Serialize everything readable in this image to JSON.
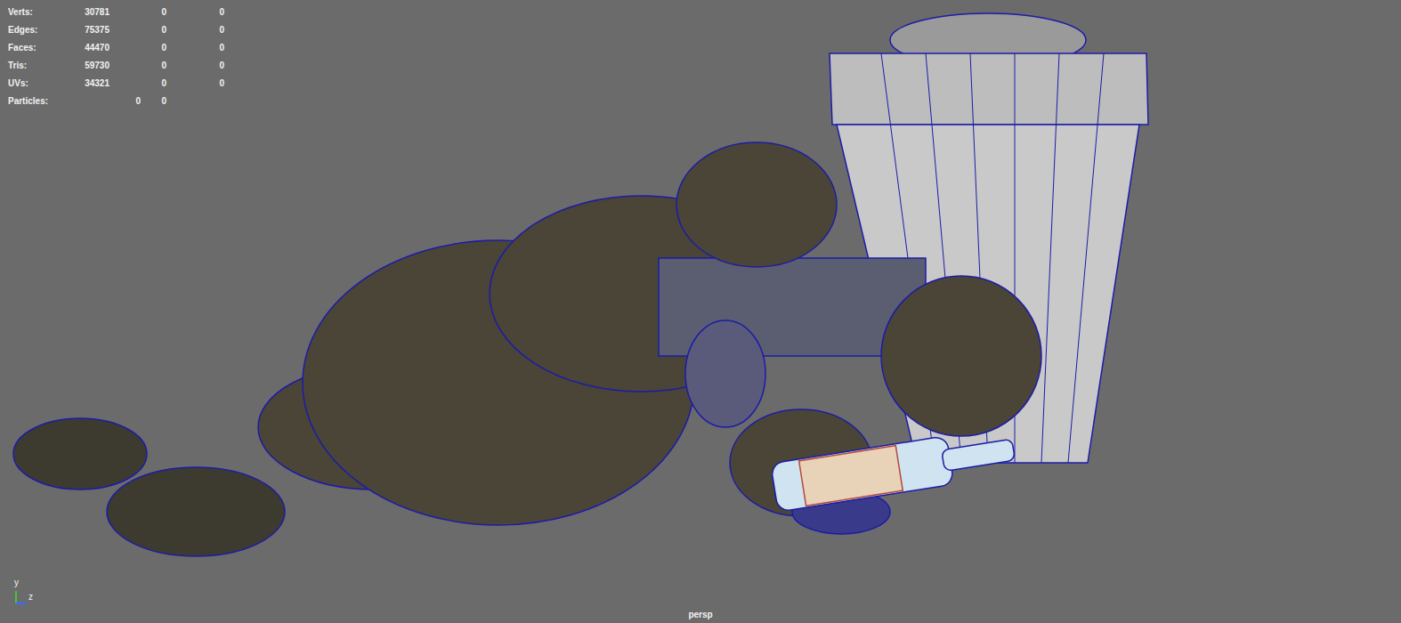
{
  "hud": {
    "rows": [
      {
        "label": "Verts:",
        "kind": "triple",
        "values": [
          "30781",
          "0",
          "0"
        ]
      },
      {
        "label": "Edges:",
        "kind": "triple",
        "values": [
          "75375",
          "0",
          "0"
        ]
      },
      {
        "label": "Faces:",
        "kind": "triple",
        "values": [
          "44470",
          "0",
          "0"
        ]
      },
      {
        "label": "Tris:",
        "kind": "triple",
        "values": [
          "59730",
          "0",
          "0"
        ]
      },
      {
        "label": "UVs:",
        "kind": "triple",
        "values": [
          "34321",
          "0",
          "0"
        ]
      },
      {
        "label": "Particles:",
        "kind": "pair",
        "values": [
          "0",
          "0"
        ]
      }
    ]
  },
  "viewport": {
    "camera": "persp"
  },
  "axis": {
    "y": "y",
    "z": "z"
  }
}
